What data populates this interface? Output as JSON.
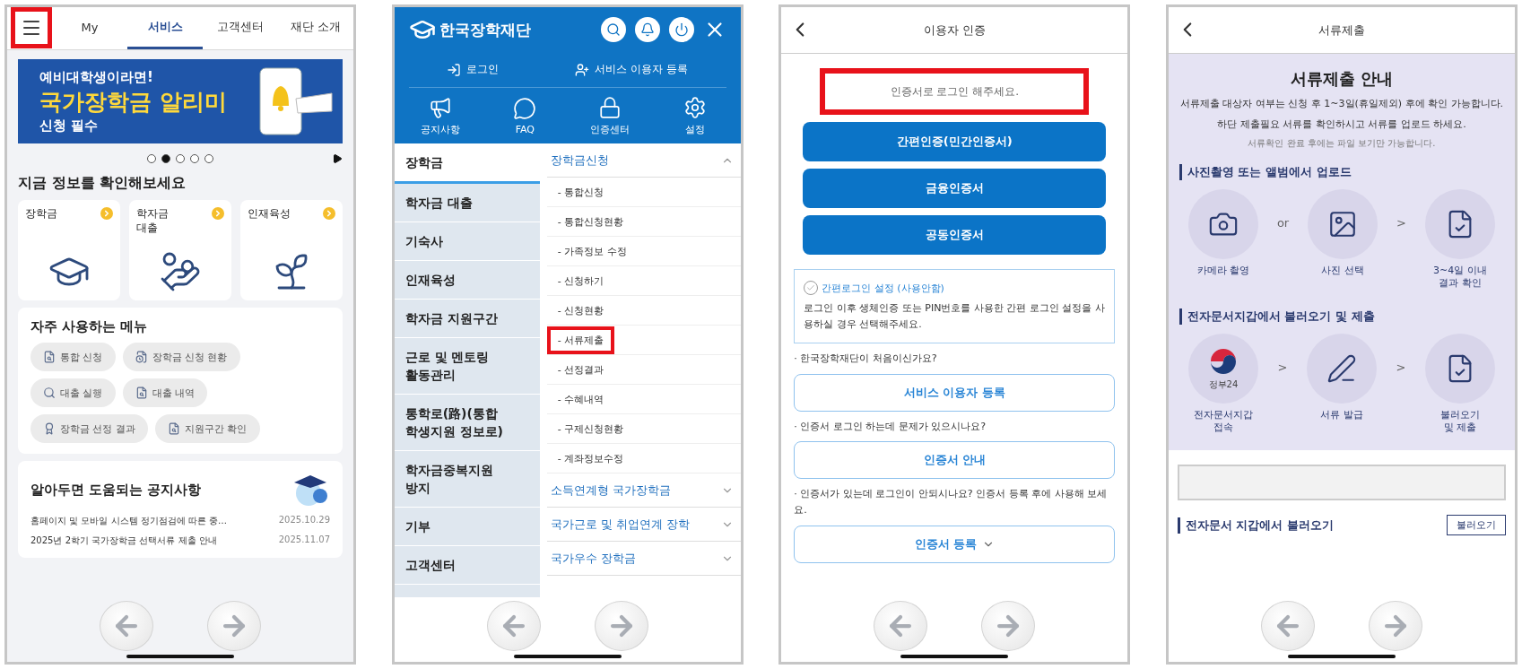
{
  "home": {
    "menu_button": {
      "highlighted": true
    },
    "tabs": [
      {
        "label": "My",
        "selected": false
      },
      {
        "label": "서비스",
        "selected": true
      },
      {
        "label": "고객센터",
        "selected": false
      },
      {
        "label": "재단 소개",
        "selected": false
      }
    ],
    "banner": {
      "lines": [
        "예비대학생이라면!",
        "국가장학금 알리미",
        "신청 필수"
      ]
    },
    "carousel": [
      {
        "selected": false
      },
      {
        "selected": true
      },
      {
        "selected": false
      },
      {
        "selected": false
      },
      {
        "selected": false
      }
    ],
    "info_heading": "지금 정보를 확인해보세요",
    "info_cards": [
      {
        "label": "장학금",
        "kind": "cap"
      },
      {
        "label": "학자금\n대출",
        "kind": "money"
      },
      {
        "label": "인재육성",
        "kind": "sprout"
      }
    ],
    "frequent_menu": {
      "title": "자주 사용하는 메뉴",
      "items": [
        {
          "label": "통합 신청",
          "kind": "search"
        },
        {
          "label": "장학금 신청 현황",
          "kind": "status"
        },
        {
          "label": "대출 실행",
          "kind": "loan"
        },
        {
          "label": "대출 내역",
          "kind": "search"
        },
        {
          "label": "장학금 선정 결과",
          "kind": "award"
        },
        {
          "label": "지원구간 확인",
          "kind": "search"
        }
      ]
    },
    "notices": {
      "title": "알아두면 도움되는 공지사항",
      "items": [
        {
          "title": "홈페이지 및 모바일 시스템 정기점검에 따른 중…",
          "date": "2025.10.29"
        },
        {
          "title": "2025년 2학기 국가장학금 선택서류 제출 안내",
          "date": "2025.11.07"
        }
      ]
    }
  },
  "menu": {
    "logo": "한국장학재단",
    "account_links": [
      {
        "label": "로그인",
        "kind": "login"
      },
      {
        "label": "서비스 이용자 등록",
        "kind": "register"
      }
    ],
    "shortcuts": [
      {
        "label": "공지사항",
        "kind": "notice"
      },
      {
        "label": "FAQ",
        "kind": "faq"
      },
      {
        "label": "인증센터",
        "kind": "lock"
      },
      {
        "label": "설정",
        "kind": "settings"
      }
    ],
    "categories": [
      {
        "label": "장학금",
        "selected": true
      },
      {
        "label": "학자금 대출",
        "selected": false
      },
      {
        "label": "기숙사",
        "selected": false
      },
      {
        "label": "인재육성",
        "selected": false
      },
      {
        "label": "학자금 지원구간",
        "selected": false
      },
      {
        "label": "근로 및 멘토링\n활동관리",
        "selected": false
      },
      {
        "label": "통학로(路)(통합\n학생지원 정보로)",
        "selected": false
      },
      {
        "label": "학자금중복지원\n방지",
        "selected": false
      },
      {
        "label": "기부",
        "selected": false
      },
      {
        "label": "고객센터",
        "selected": false
      }
    ],
    "groups": [
      {
        "label": "장학금신청",
        "expanded": true,
        "items": [
          {
            "label": "- 통합신청",
            "highlighted": false
          },
          {
            "label": "- 통합신청현황",
            "highlighted": false
          },
          {
            "label": "- 가족정보 수정",
            "highlighted": false
          },
          {
            "label": "- 신청하기",
            "highlighted": false
          },
          {
            "label": "- 신청현황",
            "highlighted": false
          },
          {
            "label": "- 서류제출",
            "highlighted": true
          },
          {
            "label": "- 선정결과",
            "highlighted": false
          },
          {
            "label": "- 수혜내역",
            "highlighted": false
          },
          {
            "label": "- 구제신청현황",
            "highlighted": false
          },
          {
            "label": "- 계좌정보수정",
            "highlighted": false
          }
        ]
      },
      {
        "label": "소득연계형 국가장학금",
        "expanded": false
      },
      {
        "label": "국가근로 및 취업연계 장학",
        "expanded": false
      },
      {
        "label": "국가우수 장학금",
        "expanded": false
      }
    ]
  },
  "auth": {
    "title": "이용자 인증",
    "prompt": {
      "text": "인증서로 로그인 해주세요.",
      "highlighted": true
    },
    "login_buttons": [
      "간편인증(민간인증서)",
      "금융인증서",
      "공동인증서"
    ],
    "easy_login": {
      "label": "간편로그인 설정 (사용안함)",
      "checked": false,
      "description": "로그인 이후 생체인증 또는 PIN번호를 사용한 간편 로그인 설정을 사용하실 경우 선택해주세요."
    },
    "help": [
      {
        "question": "· 한국장학재단이 처음이신가요?",
        "button": "서비스 이용자 등록",
        "kind": "plain"
      },
      {
        "question": "· 인증서 로그인 하는데 문제가 있으시나요?",
        "button": "인증서 안내",
        "kind": "plain"
      },
      {
        "question": "· 인증서가 있는데 로그인이 안되시나요? 인증서 등록 후에 사용해 보세요.",
        "button": "인증서 등록",
        "kind": "dropdown"
      }
    ]
  },
  "documents": {
    "title": "서류제출",
    "guide": {
      "heading": "서류제출 안내",
      "lines": [
        "서류제출 대상자 여부는 신청 후 1~3일(휴일제외) 후에 확인 가능합니다.",
        "하단 제출필요 서류를 확인하시고 서류를 업로드 하세요."
      ],
      "note": "서류확인 완료 후에는 파일 보기만 가능합니다."
    },
    "sections": [
      {
        "heading": "사진촬영 또는 앨범에서 업로드",
        "steps": [
          {
            "kind": "camera",
            "label": "카메라 촬영"
          },
          {
            "kind": "separator",
            "text": "or"
          },
          {
            "kind": "photo",
            "label": "사진 선택"
          },
          {
            "kind": "separator",
            "text": ">"
          },
          {
            "kind": "result",
            "label": "3~4일 이내\n결과 확인"
          }
        ]
      },
      {
        "heading": "전자문서지갑에서 불러오기 및 제출",
        "steps": [
          {
            "kind": "gov24",
            "badge": "정부24",
            "label": "전자문서지갑\n접속"
          },
          {
            "kind": "separator",
            "text": ">"
          },
          {
            "kind": "issue",
            "label": "서류 발급"
          },
          {
            "kind": "separator",
            "text": ">"
          },
          {
            "kind": "result",
            "label": "불러오기\n및 제출"
          }
        ]
      }
    ],
    "wallet_row": {
      "label": "전자문서 지갑에서 불러오기",
      "button": "불러오기"
    }
  }
}
